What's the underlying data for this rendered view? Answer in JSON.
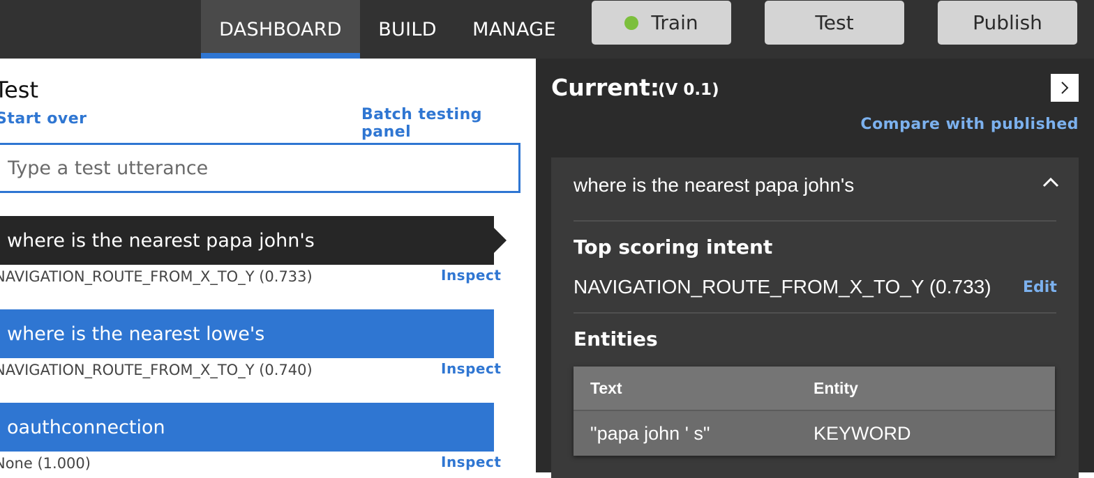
{
  "nav": {
    "tabs": [
      {
        "label": "DASHBOARD",
        "active": true
      },
      {
        "label": "BUILD",
        "active": false
      },
      {
        "label": "MANAGE",
        "active": false
      }
    ],
    "buttons": {
      "train": "Train",
      "test": "Test",
      "publish": "Publish"
    },
    "train_status_color": "#7cbf3c"
  },
  "test_panel": {
    "title": "Test",
    "start_over": "Start over",
    "batch_testing": "Batch testing panel",
    "input_placeholder": "Type a test utterance",
    "utterances": [
      {
        "text": "where is the nearest papa john's",
        "intent": "NAVIGATION_ROUTE_FROM_X_TO_Y (0.733)",
        "inspect": "Inspect",
        "selected": true
      },
      {
        "text": "where is the nearest lowe's",
        "intent": "NAVIGATION_ROUTE_FROM_X_TO_Y (0.740)",
        "inspect": "Inspect",
        "selected": false
      },
      {
        "text": "oauthconnection",
        "intent": "None (1.000)",
        "inspect": "Inspect",
        "selected": false
      }
    ]
  },
  "inspect_panel": {
    "current_label": "Current:",
    "version": "(V 0.1)",
    "compare_link": "Compare with published",
    "utterance": "where is the nearest papa john's",
    "top_scoring_title": "Top scoring intent",
    "top_intent": "NAVIGATION_ROUTE_FROM_X_TO_Y (0.733)",
    "edit": "Edit",
    "entities_title": "Entities",
    "entities": {
      "headers": [
        "Text",
        "Entity"
      ],
      "rows": [
        [
          "\"papa john ' s\"",
          "KEYWORD"
        ]
      ]
    }
  },
  "colors": {
    "accent_blue": "#2f76d2",
    "light_blue": "#7cb1ee",
    "nav_bg": "#323232",
    "panel_dark": "#2b2b2b"
  }
}
